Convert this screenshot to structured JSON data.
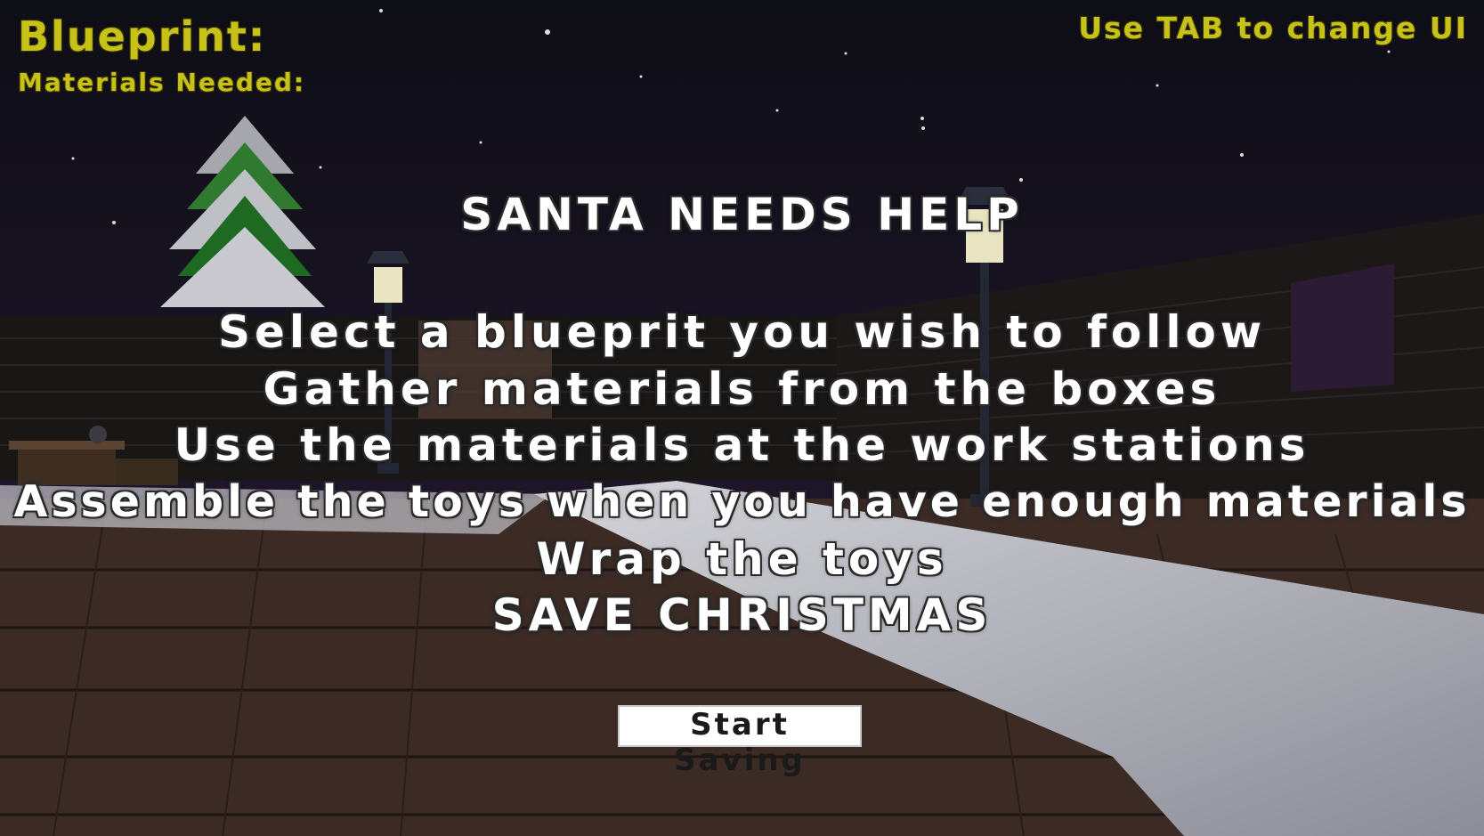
{
  "hud": {
    "blueprint_label": "Blueprint:",
    "materials_label": "Materials Needed:",
    "tab_hint": "Use TAB to change UI"
  },
  "intro": {
    "headline": "SANTA NEEDS HELP",
    "steps": [
      "Select a blueprit you wish to follow",
      "Gather materials from the boxes",
      "Use the materials at the work stations",
      "Assemble the toys when you have enough materials",
      "Wrap the toys",
      "SAVE CHRISTMAS"
    ]
  },
  "start_button_label": "Start Saving",
  "colors": {
    "hud_text": "#c6c21a",
    "intro_text": "#ffffff",
    "sky": "#1a1225",
    "deck": "#3a2a22",
    "snow": "#b9b9c2"
  }
}
